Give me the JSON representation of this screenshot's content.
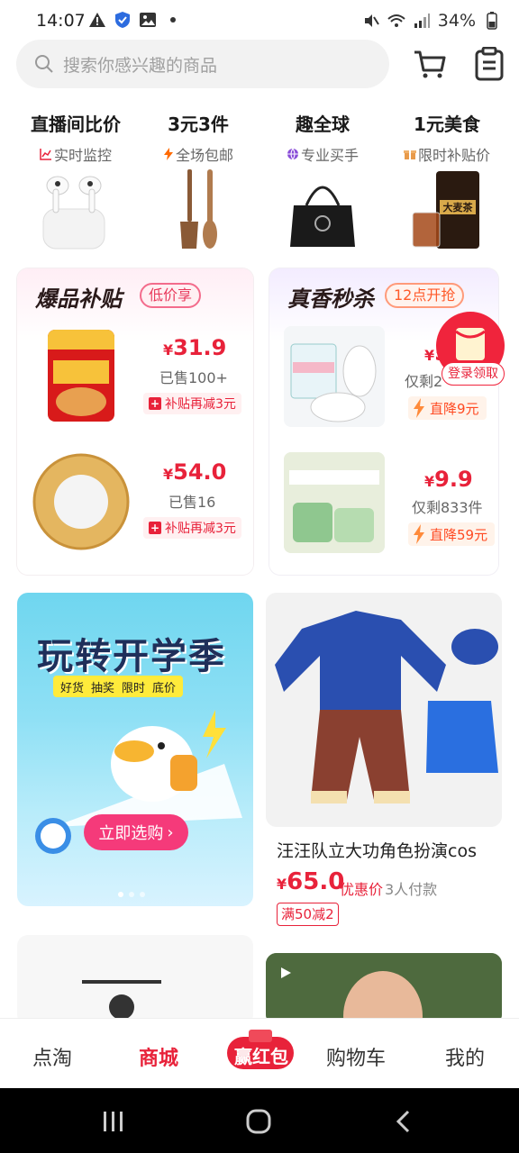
{
  "status_bar": {
    "time": "14:07",
    "battery": "34%"
  },
  "search": {
    "placeholder": "搜索你感兴趣的商品"
  },
  "categories": [
    {
      "title": "直播间比价",
      "subtitle": "实时监控"
    },
    {
      "title": "3元3件",
      "subtitle": "全场包邮"
    },
    {
      "title": "趣全球",
      "subtitle": "专业买手"
    },
    {
      "title": "1元美食",
      "subtitle": "限时补贴价"
    }
  ],
  "card_hot": {
    "title": "爆品补贴",
    "tag": "低价享",
    "items": [
      {
        "price": "31.9",
        "currency": "¥",
        "sold": "已售100+",
        "badge": "补贴再减3元"
      },
      {
        "price": "54.0",
        "currency": "¥",
        "sold": "已售16",
        "badge": "补贴再减3元"
      }
    ]
  },
  "card_flash": {
    "title": "真香秒杀",
    "tag": "12点开抢",
    "items": [
      {
        "price": "5",
        "currency": "¥",
        "stock": "仅剩2",
        "badge": "直降9元"
      },
      {
        "price": "9.9",
        "currency": "¥",
        "stock": "仅剩833件",
        "badge": "直降59元"
      }
    ]
  },
  "red_packet": {
    "label": "登录领取"
  },
  "banner": {
    "title": "玩转开学季",
    "tags": [
      "好货",
      "抽奖",
      "限时",
      "底价"
    ],
    "button": "立即选购",
    "page_count": 3,
    "active_page": 1
  },
  "product": {
    "name": "汪汪队立大功角色扮演cos",
    "currency": "¥",
    "price": "65.0",
    "price_label": "优惠价",
    "buyers": "3人付款",
    "coupon": "满50减2"
  },
  "tabs": [
    {
      "label": "点淘",
      "active": false
    },
    {
      "label": "商城",
      "active": true
    },
    {
      "label": "赢红包",
      "active": false
    },
    {
      "label": "购物车",
      "active": false
    },
    {
      "label": "我的",
      "active": false
    }
  ],
  "colors": {
    "accent": "#e8223a",
    "search_bg": "#f2f2f2"
  }
}
